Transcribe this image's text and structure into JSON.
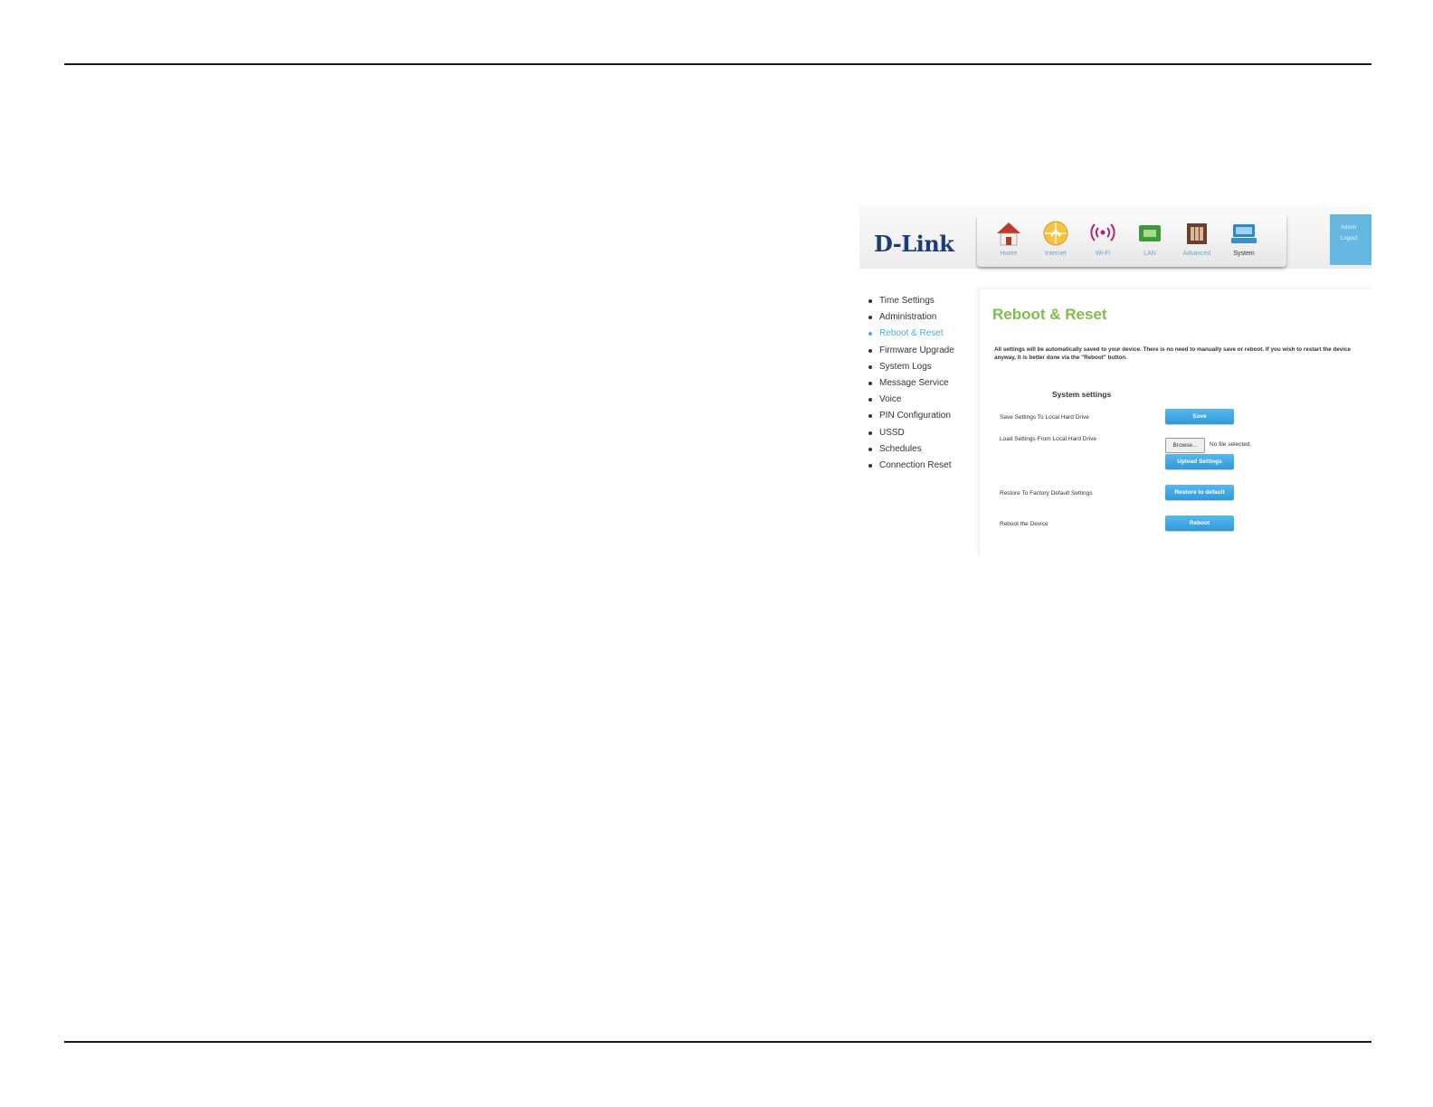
{
  "header": {
    "logo": "D-Link",
    "nav": [
      {
        "label": "Home",
        "icon": "home-icon"
      },
      {
        "label": "Internet",
        "icon": "internet-icon"
      },
      {
        "label": "Wi-Fi",
        "icon": "wifi-icon"
      },
      {
        "label": "LAN",
        "icon": "lan-icon"
      },
      {
        "label": "Advanced",
        "icon": "advanced-icon"
      },
      {
        "label": "System",
        "icon": "system-icon",
        "active": true
      }
    ],
    "user_menu": [
      "Admin",
      "Logout"
    ]
  },
  "sidebar": {
    "items": [
      {
        "label": "Time Settings"
      },
      {
        "label": "Administration"
      },
      {
        "label": "Reboot & Reset",
        "active": true
      },
      {
        "label": "Firmware Upgrade"
      },
      {
        "label": "System Logs"
      },
      {
        "label": "Message Service"
      },
      {
        "label": "Voice"
      },
      {
        "label": "PIN Configuration"
      },
      {
        "label": "USSD"
      },
      {
        "label": "Schedules"
      },
      {
        "label": "Connection Reset"
      }
    ]
  },
  "main": {
    "title": "Reboot & Reset",
    "description": "All settings will be automatically saved to your device. There is no need to manually save or reboot. If you wish to restart the device anyway, it is better done via the \"Reboot\" button.",
    "section_title": "System settings",
    "rows": {
      "save_label": "Save Settings To Local Hard Drive",
      "save_button": "Save",
      "load_label": "Load Settings From Local Hard Drive",
      "browse_button": "Browse...",
      "file_status": "No file selected.",
      "upload_button": "Upload Settings",
      "restore_label": "Restore To Factory Default Settings",
      "restore_button": "Restore to default",
      "reboot_label": "Reboot the Device",
      "reboot_button": "Reboot"
    }
  },
  "colors": {
    "title_green": "#7bbf4a",
    "button_blue": "#3fa6e0",
    "active_link": "#4fa8d8",
    "logo_navy": "#1c3c78"
  }
}
